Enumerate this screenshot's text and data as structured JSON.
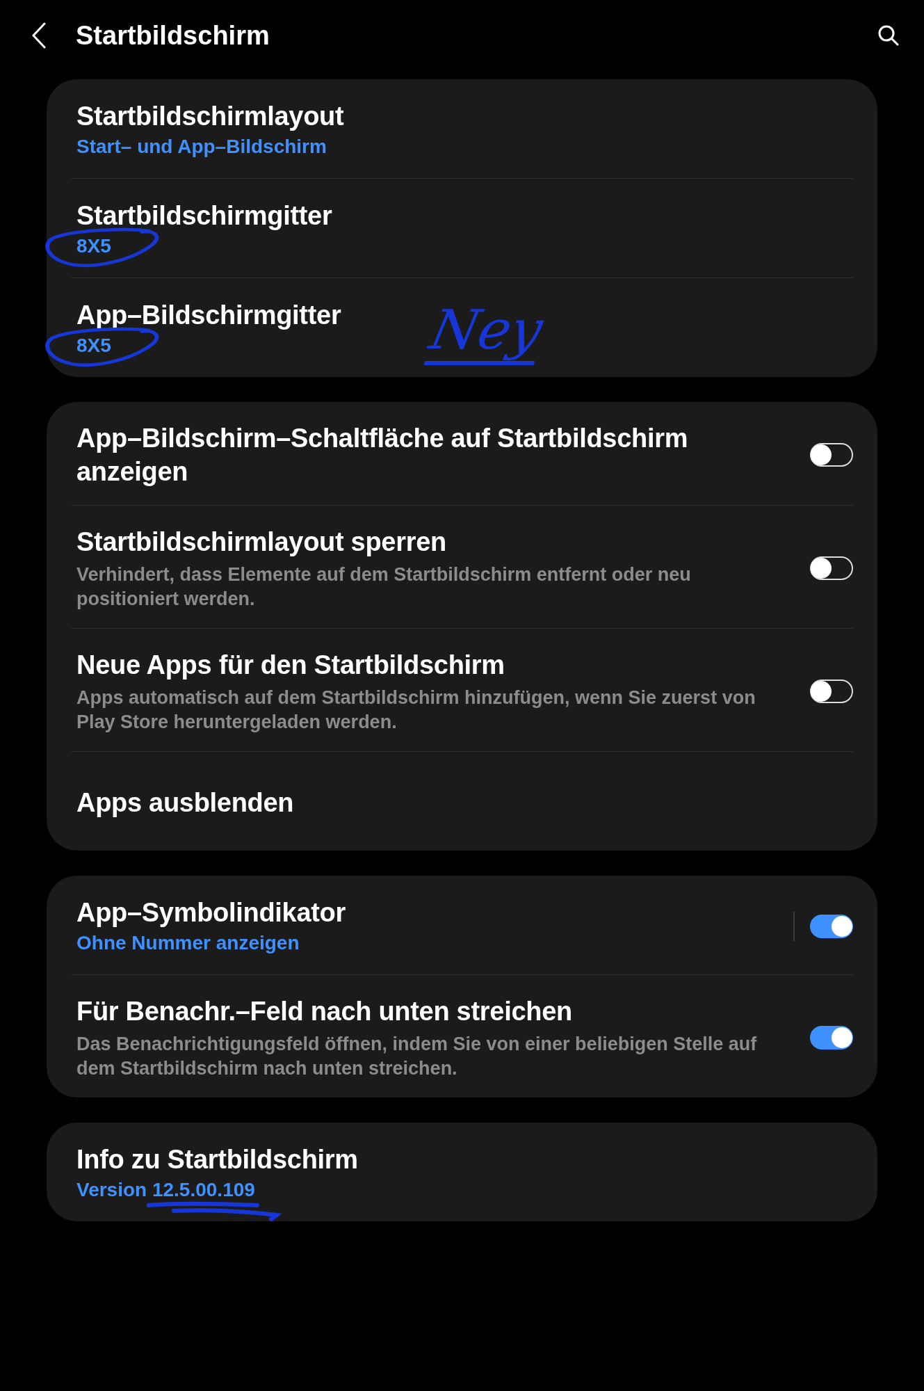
{
  "header": {
    "title": "Startbildschirm"
  },
  "groups": [
    {
      "items": [
        {
          "kind": "link",
          "title": "Startbildschirmlayout",
          "subtitle": "Start– und App–Bildschirm"
        },
        {
          "kind": "link",
          "title": "Startbildschirmgitter",
          "subtitle": "8X5",
          "circled": true
        },
        {
          "kind": "link",
          "title": "App–Bildschirmgitter",
          "subtitle": "8X5",
          "circled": true,
          "handwritten_note": "Ney"
        }
      ]
    },
    {
      "items": [
        {
          "kind": "toggle",
          "title": "App–Bildschirm–Schaltfläche auf Startbildschirm anzeigen",
          "on": false
        },
        {
          "kind": "toggle",
          "title": "Startbildschirmlayout sperren",
          "description": "Verhindert, dass Elemente auf dem Startbildschirm entfernt oder neu positioniert werden.",
          "on": false
        },
        {
          "kind": "toggle",
          "title": "Neue Apps für den Startbildschirm",
          "description": "Apps automatisch auf dem Startbildschirm hinzufügen, wenn Sie zuerst von Play Store heruntergeladen werden.",
          "on": false
        },
        {
          "kind": "link",
          "title": "Apps ausblenden"
        }
      ]
    },
    {
      "items": [
        {
          "kind": "toggle",
          "title": "App–Symbolindikator",
          "subtitle": "Ohne Nummer anzeigen",
          "on": true,
          "divider": true
        },
        {
          "kind": "toggle",
          "title": "Für Benachr.–Feld nach unten streichen",
          "description": "Das Benachrichtigungsfeld öffnen, indem Sie von einer beliebigen Stelle auf dem Startbildschirm nach unten streichen.",
          "on": true
        }
      ]
    },
    {
      "items": [
        {
          "kind": "link",
          "title": "Info zu Startbildschirm",
          "subtitle": "Version 12.5.00.109",
          "underlined": true
        }
      ]
    }
  ]
}
